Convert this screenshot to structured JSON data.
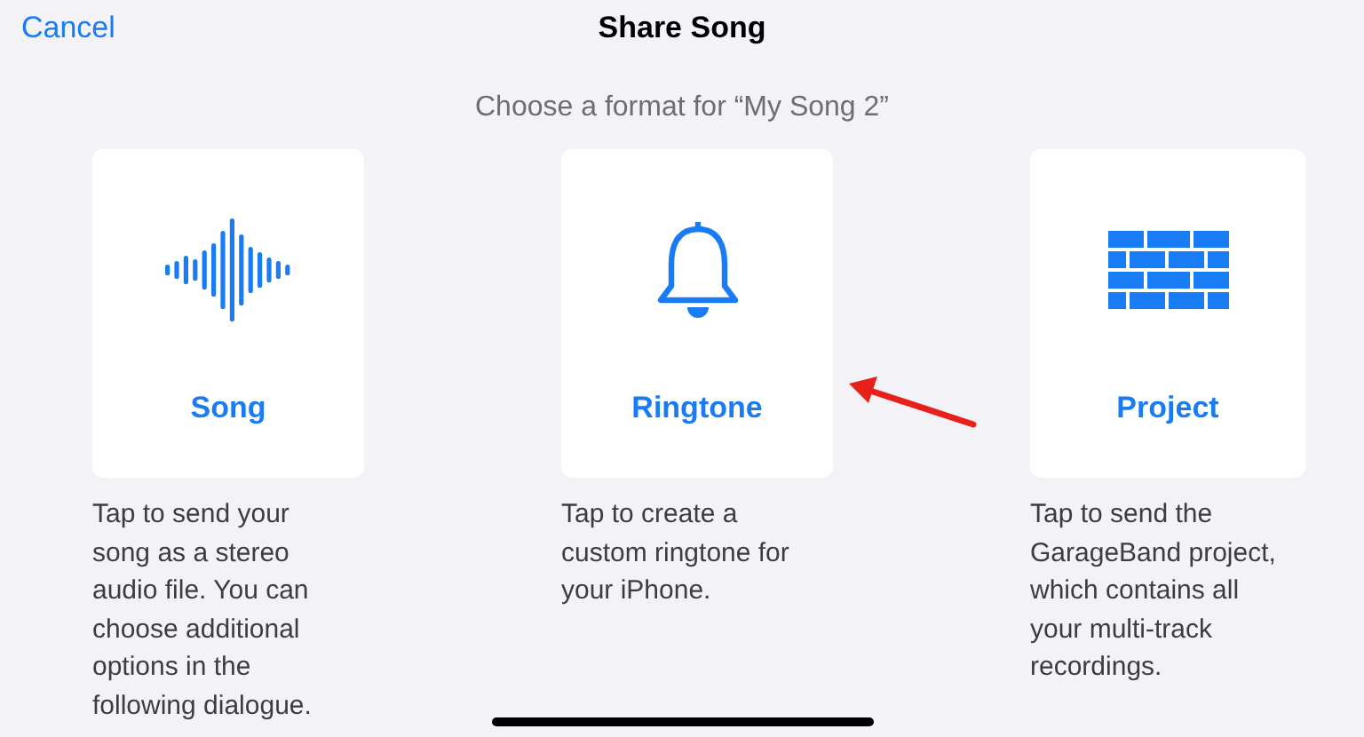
{
  "header": {
    "cancel": "Cancel",
    "title": "Share Song"
  },
  "subtitle": "Choose a format for “My Song 2”",
  "formats": [
    {
      "kind": "song",
      "label": "Song",
      "description": "Tap to send your song as a stereo audio file. You can choose additional options in the following dialogue."
    },
    {
      "kind": "ringtone",
      "label": "Ringtone",
      "description": "Tap to create a custom ringtone for your iPhone."
    },
    {
      "kind": "project",
      "label": "Project",
      "description": "Tap to send the GarageBand project, which contains all your multi-track recordings."
    }
  ]
}
